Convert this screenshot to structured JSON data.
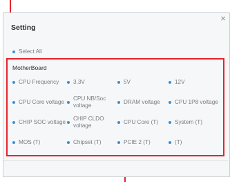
{
  "dialog": {
    "title": "Setting",
    "close_symbol": "×",
    "select_all_label": "Select All",
    "section_title": "MotherBoard",
    "items": [
      {
        "label": "CPU Frequency"
      },
      {
        "label": "3.3V"
      },
      {
        "label": "5V"
      },
      {
        "label": "12V"
      },
      {
        "label": "CPU Core voltage"
      },
      {
        "label": "CPU NB/Soc voltage"
      },
      {
        "label": "DRAM voltage"
      },
      {
        "label": "CPU 1P8 voltage"
      },
      {
        "label": "CHIP SOC voltage"
      },
      {
        "label": "CHIP CLDO voltage"
      },
      {
        "label": "CPU Core (T)"
      },
      {
        "label": "System (T)"
      },
      {
        "label": "MOS (T)"
      },
      {
        "label": "Chipset (T)"
      },
      {
        "label": "PCIE 2 (T)"
      },
      {
        "label": "(T)"
      }
    ]
  },
  "colors": {
    "accent_dot": "#3a8fd6",
    "highlight": "#e3242b",
    "text_muted": "#777c82"
  }
}
